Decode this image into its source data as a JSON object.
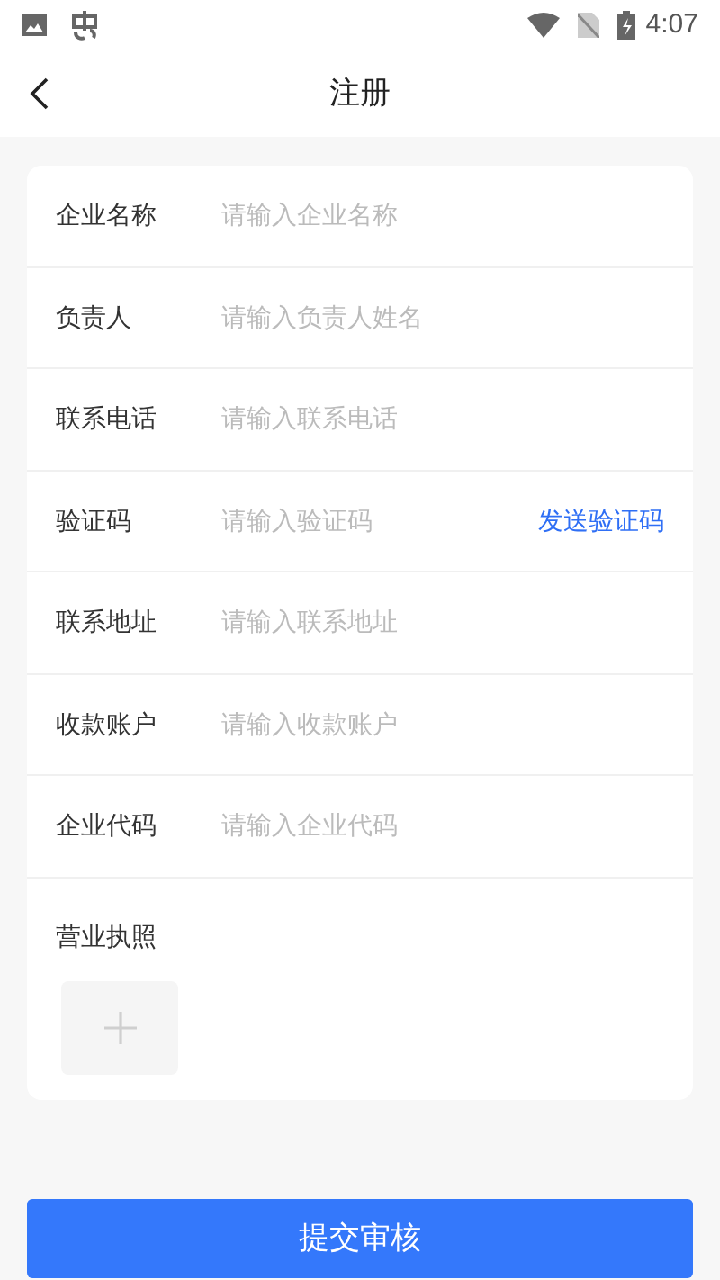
{
  "status_bar": {
    "time": "4:07"
  },
  "header": {
    "title": "注册"
  },
  "form": {
    "fields": [
      {
        "kind": "input",
        "label": "企业名称",
        "placeholder": "请输入企业名称"
      },
      {
        "kind": "input",
        "label": "负责人",
        "placeholder": "请输入负责人姓名"
      },
      {
        "kind": "input",
        "label": "联系电话",
        "placeholder": "请输入联系电话"
      },
      {
        "kind": "code",
        "label": "验证码",
        "placeholder": "请输入验证码",
        "action": "发送验证码"
      },
      {
        "kind": "input",
        "label": "联系地址",
        "placeholder": "请输入联系地址"
      },
      {
        "kind": "input",
        "label": "收款账户",
        "placeholder": "请输入收款账户"
      },
      {
        "kind": "input",
        "label": "企业代码",
        "placeholder": "请输入企业代码"
      },
      {
        "kind": "upload",
        "label": "营业执照"
      }
    ]
  },
  "submit_button": {
    "label": "提交审核"
  }
}
